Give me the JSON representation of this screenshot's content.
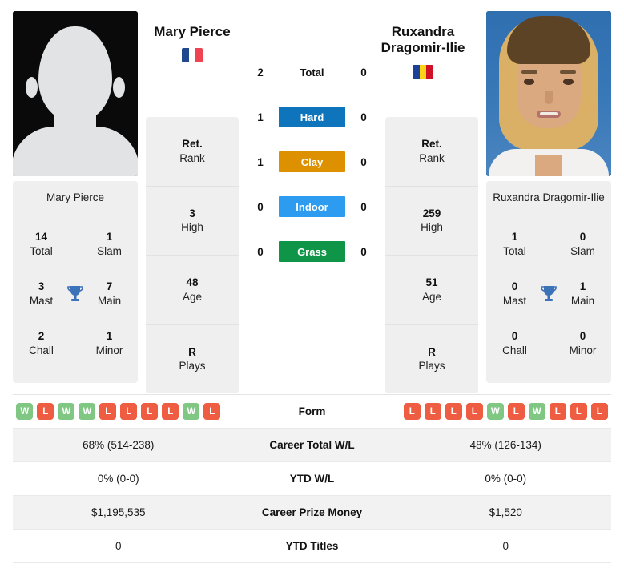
{
  "players": {
    "left": {
      "name": "Mary Pierce",
      "name_label": "Mary Pierce",
      "country_name": "France",
      "flag_colors": [
        "#21478F",
        "#FFFFFF",
        "#EF4352"
      ],
      "avatar_type": "placeholder-silhouette",
      "titles": {
        "total_num": "14",
        "total_lbl": "Total",
        "slam_num": "1",
        "slam_lbl": "Slam",
        "mast_num": "3",
        "mast_lbl": "Mast",
        "main_num": "7",
        "main_lbl": "Main",
        "chall_num": "2",
        "chall_lbl": "Chall",
        "minor_num": "1",
        "minor_lbl": "Minor"
      },
      "stats": [
        {
          "value": "Ret.",
          "label": "Rank"
        },
        {
          "value": "3",
          "label": "High"
        },
        {
          "value": "48",
          "label": "Age"
        },
        {
          "value": "R",
          "label": "Plays"
        }
      ],
      "form": [
        "W",
        "L",
        "W",
        "W",
        "L",
        "L",
        "L",
        "L",
        "W",
        "L"
      ],
      "career_wl": "68% (514-238)",
      "ytd_wl": "0% (0-0)",
      "career_prize": "$1,195,535",
      "ytd_titles": "0"
    },
    "right": {
      "name": "Ruxandra Dragomir-Ilie",
      "name_label": "Ruxandra Dragomir-Ilie",
      "country_name": "Romania",
      "flag_colors": [
        "#1B4298",
        "#FCD116",
        "#CE1126"
      ],
      "avatar_type": "photo",
      "titles": {
        "total_num": "1",
        "total_lbl": "Total",
        "slam_num": "0",
        "slam_lbl": "Slam",
        "mast_num": "0",
        "mast_lbl": "Mast",
        "main_num": "1",
        "main_lbl": "Main",
        "chall_num": "0",
        "chall_lbl": "Chall",
        "minor_num": "0",
        "minor_lbl": "Minor"
      },
      "stats": [
        {
          "value": "Ret.",
          "label": "Rank"
        },
        {
          "value": "259",
          "label": "High"
        },
        {
          "value": "51",
          "label": "Age"
        },
        {
          "value": "R",
          "label": "Plays"
        }
      ],
      "form": [
        "L",
        "L",
        "L",
        "L",
        "W",
        "L",
        "W",
        "L",
        "L",
        "L"
      ],
      "career_wl": "48% (126-134)",
      "ytd_wl": "0% (0-0)",
      "career_prize": "$1,520",
      "ytd_titles": "0"
    }
  },
  "head_to_head": [
    {
      "left": "2",
      "label": "Total",
      "right": "0",
      "color": "none",
      "plain": true
    },
    {
      "left": "1",
      "label": "Hard",
      "right": "0",
      "color": "#0E74BC",
      "plain": false
    },
    {
      "left": "1",
      "label": "Clay",
      "right": "0",
      "color": "#DD9000",
      "plain": false
    },
    {
      "left": "0",
      "label": "Indoor",
      "right": "0",
      "color": "#2C9BF0",
      "plain": false
    },
    {
      "left": "0",
      "label": "Grass",
      "right": "0",
      "color": "#0E9547",
      "plain": false
    }
  ],
  "comparison_rows": [
    {
      "label": "Form",
      "left": "",
      "right": "",
      "type": "form",
      "shade": false
    },
    {
      "label": "Career Total W/L",
      "left": "68% (514-238)",
      "right": "48% (126-134)",
      "type": "text",
      "shade": true
    },
    {
      "label": "YTD W/L",
      "left": "0% (0-0)",
      "right": "0% (0-0)",
      "type": "text",
      "shade": false
    },
    {
      "label": "Career Prize Money",
      "left": "$1,195,535",
      "right": "$1,520",
      "type": "text",
      "shade": true
    },
    {
      "label": "YTD Titles",
      "left": "0",
      "right": "0",
      "type": "text",
      "shade": false
    }
  ],
  "badge_colors": {
    "W": "#7FC783",
    "L": "#EE5C42"
  },
  "trophy_color": "#3C72B8"
}
